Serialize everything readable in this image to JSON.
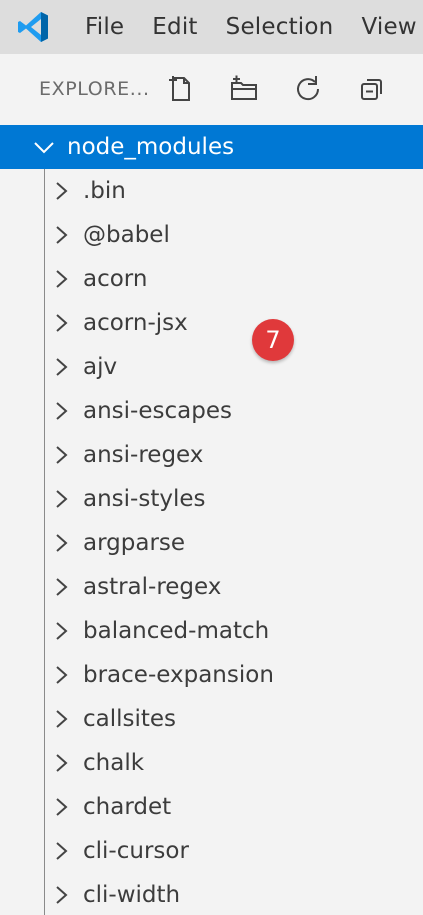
{
  "menubar": {
    "logo_icon": "vscode-logo-icon",
    "items": [
      "File",
      "Edit",
      "Selection",
      "View"
    ]
  },
  "explorer": {
    "title": "EXPLORE...",
    "actions": [
      {
        "icon": "new-file-icon"
      },
      {
        "icon": "new-folder-icon"
      },
      {
        "icon": "refresh-icon"
      },
      {
        "icon": "collapse-all-icon"
      }
    ]
  },
  "tree": {
    "root": {
      "label": "node_modules",
      "expanded": true
    },
    "children": [
      ".bin",
      "@babel",
      "acorn",
      "acorn-jsx",
      "ajv",
      "ansi-escapes",
      "ansi-regex",
      "ansi-styles",
      "argparse",
      "astral-regex",
      "balanced-match",
      "brace-expansion",
      "callsites",
      "chalk",
      "chardet",
      "cli-cursor",
      "cli-width"
    ]
  },
  "badge": {
    "value": "7"
  },
  "colors": {
    "accent": "#0078d4",
    "badge": "#e0393b",
    "menubar_bg": "#dddddd",
    "sidebar_bg": "#f3f3f3",
    "logo_blue": "#1f9cf0"
  }
}
